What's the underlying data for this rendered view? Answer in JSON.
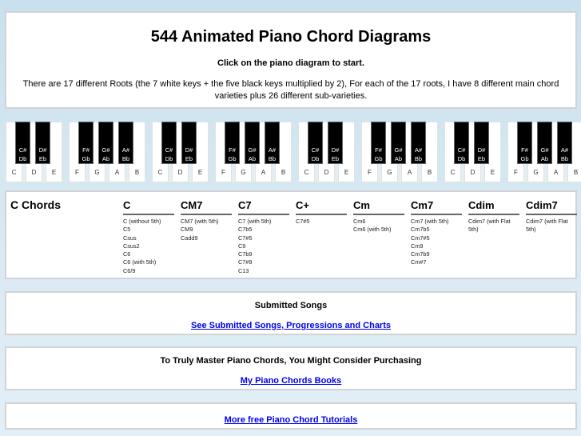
{
  "header": {
    "title": "544 Animated Piano Chord Diagrams",
    "subtitle": "Click on the piano diagram to start.",
    "description": "There are 17 different Roots (the 7 white keys + the five black keys multiplied by 2), For each of the 17 roots, I have 8 different main chord varieties plus 26 different sub-varieties."
  },
  "keyboard": {
    "groups": [
      {
        "white": [
          "C",
          "D",
          "E"
        ],
        "black": [
          [
            "C#",
            "Db"
          ],
          [
            "D#",
            "Eb"
          ]
        ]
      },
      {
        "white": [
          "F",
          "G",
          "A",
          "B"
        ],
        "black": [
          [
            "F#",
            "Gb"
          ],
          [
            "G#",
            "Ab"
          ],
          [
            "A#",
            "Bb"
          ]
        ]
      },
      {
        "white": [
          "C",
          "D",
          "E"
        ],
        "black": [
          [
            "C#",
            "Db"
          ],
          [
            "D#",
            "Eb"
          ]
        ]
      },
      {
        "white": [
          "F",
          "G",
          "A",
          "B"
        ],
        "black": [
          [
            "F#",
            "Gb"
          ],
          [
            "G#",
            "Ab"
          ],
          [
            "A#",
            "Bb"
          ]
        ]
      },
      {
        "white": [
          "C",
          "D",
          "E"
        ],
        "black": [
          [
            "C#",
            "Db"
          ],
          [
            "D#",
            "Eb"
          ]
        ]
      },
      {
        "white": [
          "F",
          "G",
          "A",
          "B"
        ],
        "black": [
          [
            "F#",
            "Gb"
          ],
          [
            "G#",
            "Ab"
          ],
          [
            "A#",
            "Bb"
          ]
        ]
      },
      {
        "white": [
          "C",
          "D",
          "E"
        ],
        "black": [
          [
            "C#",
            "Db"
          ],
          [
            "D#",
            "Eb"
          ]
        ]
      },
      {
        "white": [
          "F",
          "G",
          "A",
          "B"
        ],
        "black": [
          [
            "F#",
            "Gb"
          ],
          [
            "G#",
            "Ab"
          ],
          [
            "A#",
            "Bb"
          ]
        ]
      }
    ]
  },
  "chords": {
    "title": "C Chords",
    "columns": [
      {
        "heading": "C",
        "items": [
          "C (without 5th)",
          "C5",
          "Csus",
          "Csus2",
          "C6",
          "C6 (with 5th)",
          "C6/9"
        ]
      },
      {
        "heading": "CM7",
        "items": [
          "CM7 (with 5th)",
          "CM9",
          "Cadd9"
        ]
      },
      {
        "heading": "C7",
        "items": [
          "C7 (with 5th)",
          "C7b5",
          "C7#5",
          "C9",
          "C7b9",
          "C7#9",
          "C13"
        ]
      },
      {
        "heading": "C+",
        "items": [
          "C7#5"
        ]
      },
      {
        "heading": "Cm",
        "items": [
          "Cm6",
          "Cm6 (with 5th)"
        ]
      },
      {
        "heading": "Cm7",
        "items": [
          "Cm7 (with 5th)",
          "Cm7b5",
          "Cm7#5",
          "Cm9",
          "Cm7b9",
          "Cm#7"
        ]
      },
      {
        "heading": "Cdim",
        "items": [
          "Cdim7 (with Flat 5th)"
        ]
      },
      {
        "heading": "Cdim7",
        "items": [
          "Cdim7 (with Flat 5th)"
        ]
      }
    ]
  },
  "songs": {
    "title": "Submitted Songs",
    "link": "See Submitted Songs, Progressions and Charts"
  },
  "master": {
    "title": "To Truly Master Piano Chords, You Might Consider Purchasing",
    "link": "My Piano Chords Books"
  },
  "more": {
    "link": "More free Piano Chord Tutorials"
  },
  "colors": {
    "background": "#cde3f0",
    "link": "#0000ee",
    "black_key": "#000000"
  }
}
